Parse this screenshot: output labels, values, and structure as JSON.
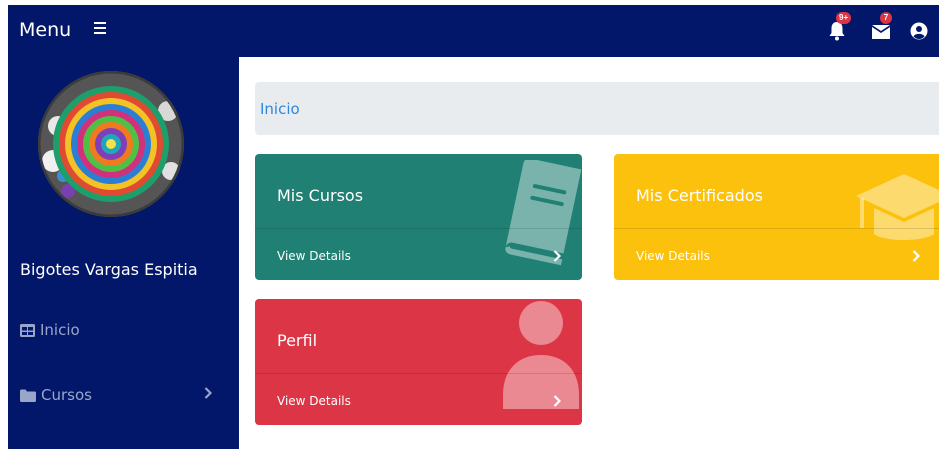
{
  "topbar": {
    "menu_label": "Menu",
    "notifications_badge": "9+",
    "messages_badge": "7"
  },
  "sidebar": {
    "user_name": "Bigotes Vargas Espitia",
    "items": [
      {
        "label": "Inicio",
        "icon": "table-icon"
      },
      {
        "label": "Cursos",
        "icon": "folder-icon"
      }
    ]
  },
  "breadcrumb": {
    "label": "Inicio"
  },
  "cards": [
    {
      "title": "Mis Cursos",
      "footer": "View Details",
      "color": "#208073",
      "icon": "book-icon"
    },
    {
      "title": "Mis Certificados",
      "footer": "View Details",
      "color": "#fcc10c",
      "icon": "graduation-cap-icon"
    },
    {
      "title": "Perfil",
      "footer": "View Details",
      "color": "#dc3545",
      "icon": "user-icon"
    }
  ],
  "colors": {
    "navbar": "#021769",
    "sidebar": "#021769",
    "breadcrumb_bg": "#e9ecef",
    "breadcrumb_text": "#2f86e0"
  }
}
